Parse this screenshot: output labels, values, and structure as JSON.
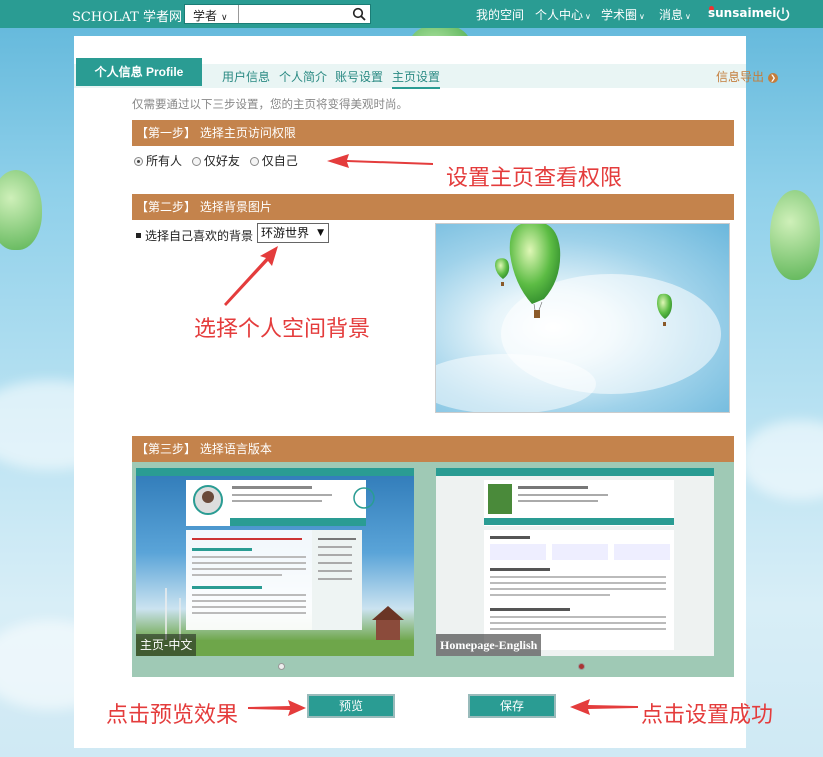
{
  "topbar": {
    "brand": "SCHOLAT 学者网",
    "search_category": "学者",
    "search_placeholder": "",
    "nav_my_space": "我的空间",
    "nav_personal_center": "个人中心",
    "nav_academic": "学术圈",
    "nav_messages": "消息",
    "username": "sunsaimei"
  },
  "profile": {
    "main_tab": "个人信息 Profile",
    "subtabs": [
      "用户信息",
      "个人简介",
      "账号设置",
      "主页设置"
    ],
    "active_subtab": "主页设置",
    "export_label": "信息导出",
    "hint": "仅需要通过以下三步设置，您的主页将变得美观时尚。"
  },
  "step1": {
    "title": "【第一步】 选择主页访问权限",
    "options": [
      "所有人",
      "仅好友",
      "仅自己"
    ],
    "selected": "所有人"
  },
  "step2": {
    "title": "【第二步】 选择背景图片",
    "label": "选择自己喜欢的背景",
    "selected_background": "环游世界"
  },
  "step3": {
    "title": "【第三步】 选择语言版本",
    "versions": [
      "主页-中文",
      "Homepage-English"
    ],
    "selected_page": 2
  },
  "buttons": {
    "preview": "预览",
    "save": "保存"
  },
  "annotations": {
    "set_permission": "设置主页查看权限",
    "choose_background": "选择个人空间背景",
    "click_preview": "点击预览效果",
    "click_save": "点击设置成功"
  },
  "colors": {
    "teal": "#2a9c93",
    "step_bar": "#c4834c",
    "annotation": "#e43c3c"
  }
}
